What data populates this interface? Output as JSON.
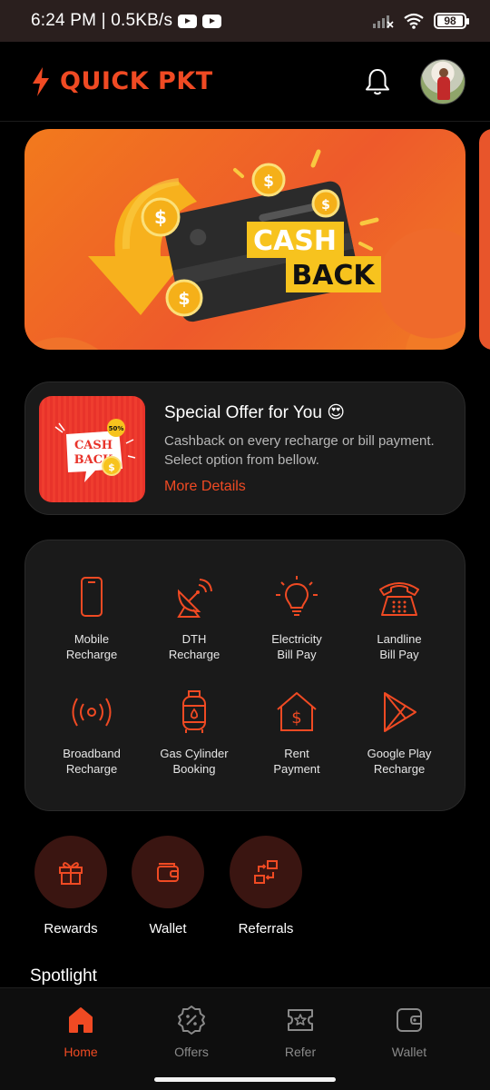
{
  "status_bar": {
    "time_text": "6:24 PM | 0.5KB/s",
    "battery": "98",
    "icons": [
      "youtube-icon",
      "youtube-icon",
      "signal-icon",
      "wifi-icon",
      "battery-icon"
    ]
  },
  "header": {
    "app_name": "QUICK PKT",
    "logo_icon": "lightning-bolt-icon",
    "notification_icon": "bell-icon",
    "avatar_icon": "user-avatar"
  },
  "banner": {
    "line1": "CASH",
    "line2": "BACK"
  },
  "offer": {
    "title": "Special Offer for You",
    "emoji": "😍",
    "description": "Cashback on every recharge or bill payment. Select option from bellow.",
    "link": "More Details",
    "thumb": {
      "line1": "CASH",
      "line2": "BACK",
      "badge": "50%"
    }
  },
  "services": [
    {
      "line1": "Mobile",
      "line2": "Recharge",
      "icon": "mobile-phone-icon"
    },
    {
      "line1": "DTH",
      "line2": "Recharge",
      "icon": "satellite-dish-icon"
    },
    {
      "line1": "Electricity",
      "line2": "Bill Pay",
      "icon": "light-bulb-icon"
    },
    {
      "line1": "Landline",
      "line2": "Bill Pay",
      "icon": "telephone-icon"
    },
    {
      "line1": "Broadband",
      "line2": "Recharge",
      "icon": "broadcast-icon"
    },
    {
      "line1": "Gas Cylinder",
      "line2": "Booking",
      "icon": "gas-cylinder-icon"
    },
    {
      "line1": "Rent",
      "line2": "Payment",
      "icon": "house-dollar-icon"
    },
    {
      "line1": "Google Play",
      "line2": "Recharge",
      "icon": "play-store-icon"
    }
  ],
  "quick_actions": [
    {
      "label": "Rewards",
      "icon": "gift-icon"
    },
    {
      "label": "Wallet",
      "icon": "wallet-icon"
    },
    {
      "label": "Referrals",
      "icon": "refer-icon"
    }
  ],
  "spotlight": {
    "title": "Spotlight"
  },
  "bottom_nav": [
    {
      "label": "Home",
      "icon": "home-icon",
      "active": true
    },
    {
      "label": "Offers",
      "icon": "discount-badge-icon",
      "active": false
    },
    {
      "label": "Refer",
      "icon": "ticket-star-icon",
      "active": false
    },
    {
      "label": "Wallet",
      "icon": "wallet-icon",
      "active": false
    }
  ],
  "colors": {
    "accent": "#f04a23",
    "card_bg": "#1a1a1a",
    "background": "#000000",
    "quick_action_bg": "#3a1511"
  }
}
